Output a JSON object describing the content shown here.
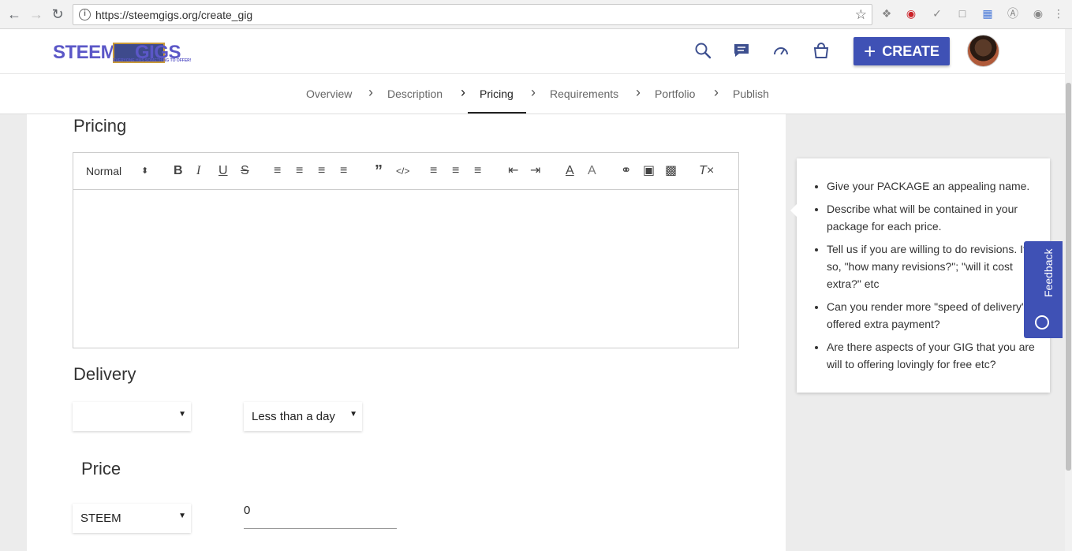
{
  "browser": {
    "url": "https://steemgigs.org/create_gig",
    "back_icon": "arrow-left-icon",
    "forward_icon": "arrow-right-icon",
    "reload_icon": "reload-icon"
  },
  "header": {
    "logo_steem": "STEEM",
    "logo_gigs": "GIGS",
    "logo_tagline": "EVERYONE HAS SOMETHING TO OFFER!",
    "create_label": "CREATE",
    "icons": [
      "search-icon",
      "chat-icon",
      "dashboard-icon",
      "shopping-bag-icon"
    ]
  },
  "steps": [
    {
      "label": "Overview"
    },
    {
      "label": "Description"
    },
    {
      "label": "Pricing"
    },
    {
      "label": "Requirements"
    },
    {
      "label": "Portfolio"
    },
    {
      "label": "Publish"
    }
  ],
  "active_step": "Pricing",
  "pricing": {
    "title": "Pricing",
    "editor": {
      "format_value": "Normal",
      "content": ""
    }
  },
  "delivery": {
    "title": "Delivery",
    "first_select_value": "",
    "second_select_value": "Less than a day"
  },
  "price": {
    "title": "Price",
    "currency": "STEEM",
    "amount": "0"
  },
  "tips": [
    "Give your PACKAGE an appealing name.",
    "Describe what will be contained in your package for each price.",
    "Tell us if you are willing to do revisions. If so, \"how many revisions?\"; \"will it cost extra?\" etc",
    "Can you render more \"speed of delivery\" if offered extra payment?",
    "Are there aspects of your GIG that you are will to offering lovingly for free etc?"
  ],
  "feedback_label": "Feedback",
  "colors": {
    "primary": "#3f51b5",
    "logo": "#5b57c7"
  }
}
